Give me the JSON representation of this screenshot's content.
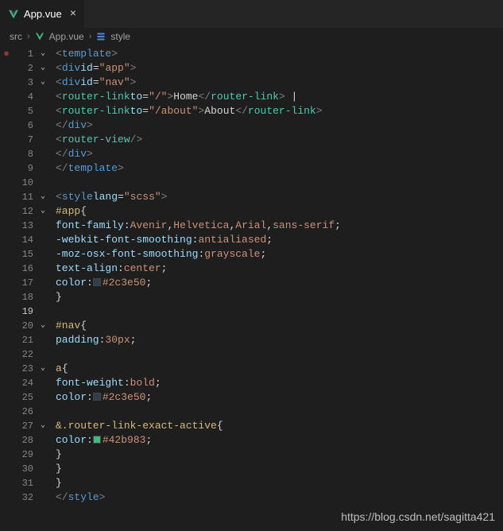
{
  "tab": {
    "filename": "App.vue",
    "close": "×"
  },
  "breadcrumb": {
    "item1": "src",
    "item2": "App.vue",
    "item3": "style",
    "chev": "›"
  },
  "lines": {
    "l1": {
      "n": "1",
      "html": "<span class='t-bracket'>&lt;</span><span class='t-tag'>template</span><span class='t-bracket'>&gt;</span>"
    },
    "l2": {
      "n": "2",
      "html": "  <span class='t-bracket'>&lt;</span><span class='t-tag'>div</span> <span class='t-attr'>id</span><span class='t-eq'>=</span><span class='t-str'>\"app\"</span><span class='t-bracket'>&gt;</span>"
    },
    "l3": {
      "n": "3",
      "html": "    <span class='t-bracket'>&lt;</span><span class='t-tag'>div</span> <span class='t-attr'>id</span><span class='t-eq'>=</span><span class='t-str'>\"nav\"</span><span class='t-bracket'>&gt;</span>"
    },
    "l4": {
      "n": "4",
      "html": "      <span class='t-bracket'>&lt;</span><span class='t-component'>router-link</span> <span class='t-attr'>to</span><span class='t-eq'>=</span><span class='t-str'>\"/\"</span><span class='t-bracket'>&gt;</span><span class='t-text'>Home</span><span class='t-bracket'>&lt;/</span><span class='t-component'>router-link</span><span class='t-bracket'>&gt;</span><span class='t-text'> |</span>"
    },
    "l5": {
      "n": "5",
      "html": "      <span class='t-bracket'>&lt;</span><span class='t-component'>router-link</span> <span class='t-attr'>to</span><span class='t-eq'>=</span><span class='t-str'>\"/about\"</span><span class='t-bracket'>&gt;</span><span class='t-text'>About</span><span class='t-bracket'>&lt;/</span><span class='t-component'>router-link</span><span class='t-bracket'>&gt;</span>"
    },
    "l6": {
      "n": "6",
      "html": "    <span class='t-bracket'>&lt;/</span><span class='t-tag'>div</span><span class='t-bracket'>&gt;</span>"
    },
    "l7": {
      "n": "7",
      "html": "    <span class='t-bracket'>&lt;</span><span class='t-component'>router-view</span><span class='t-bracket'>/&gt;</span>"
    },
    "l8": {
      "n": "8",
      "html": "  <span class='t-bracket'>&lt;/</span><span class='t-tag'>div</span><span class='t-bracket'>&gt;</span>"
    },
    "l9": {
      "n": "9",
      "html": "<span class='t-bracket'>&lt;/</span><span class='t-tag'>template</span><span class='t-bracket'>&gt;</span>"
    },
    "l10": {
      "n": "10",
      "html": ""
    },
    "l11": {
      "n": "11",
      "html": "<span class='t-bracket'>&lt;</span><span class='t-tag'>style</span> <span class='t-attr'>lang</span><span class='t-eq'>=</span><span class='t-str'>\"scss\"</span><span class='t-bracket'>&gt;</span>"
    },
    "l12": {
      "n": "12",
      "html": "<span class='t-sel'>#app</span> <span class='t-brace'>{</span>"
    },
    "l13": {
      "n": "13",
      "html": "  <span class='t-prop'>font-family</span><span class='t-colon'>:</span> <span class='t-val'>Avenir</span><span class='t-comma'>,</span> <span class='t-val'>Helvetica</span><span class='t-comma'>,</span> <span class='t-val'>Arial</span><span class='t-comma'>,</span> <span class='t-val'>sans-serif</span><span class='t-semi'>;</span>"
    },
    "l14": {
      "n": "14",
      "html": "  <span class='t-prop'>-webkit-font-smoothing</span><span class='t-colon'>:</span> <span class='t-val'>antialiased</span><span class='t-semi'>;</span>"
    },
    "l15": {
      "n": "15",
      "html": "  <span class='t-prop'>-moz-osx-font-smoothing</span><span class='t-colon'>:</span> <span class='t-val'>grayscale</span><span class='t-semi'>;</span>"
    },
    "l16": {
      "n": "16",
      "html": "  <span class='t-prop'>text-align</span><span class='t-colon'>:</span> <span class='t-val'>center</span><span class='t-semi'>;</span>"
    },
    "l17": {
      "n": "17",
      "html": "  <span class='t-prop'>color</span><span class='t-colon'>:</span> <span class='color-swatch' style='background:#2c3e50'></span><span class='t-val'>#2c3e50</span><span class='t-semi'>;</span>"
    },
    "l18": {
      "n": "18",
      "html": "<span class='t-brace'>}</span>"
    },
    "l19": {
      "n": "19",
      "html": ""
    },
    "l20": {
      "n": "20",
      "html": "<span class='t-sel'>#nav</span> <span class='t-brace'>{</span>"
    },
    "l21": {
      "n": "21",
      "html": "  <span class='t-prop'>padding</span><span class='t-colon'>:</span> <span class='t-val'>30px</span><span class='t-semi'>;</span>"
    },
    "l22": {
      "n": "22",
      "html": ""
    },
    "l23": {
      "n": "23",
      "html": "  <span class='t-sel'>a</span> <span class='t-brace'>{</span>"
    },
    "l24": {
      "n": "24",
      "html": "    <span class='t-prop'>font-weight</span><span class='t-colon'>:</span> <span class='t-val'>bold</span><span class='t-semi'>;</span>"
    },
    "l25": {
      "n": "25",
      "html": "    <span class='t-prop'>color</span><span class='t-colon'>:</span> <span class='color-swatch' style='background:#2c3e50'></span><span class='t-val'>#2c3e50</span><span class='t-semi'>;</span>"
    },
    "l26": {
      "n": "26",
      "html": ""
    },
    "l27": {
      "n": "27",
      "html": "    <span class='t-sel'>&amp;.router-link-exact-active</span> <span class='t-brace'>{</span>"
    },
    "l28": {
      "n": "28",
      "html": "      <span class='t-prop'>color</span><span class='t-colon'>:</span> <span class='color-swatch' style='background:#42b983'></span><span class='t-val'>#42b983</span><span class='t-semi'>;</span>"
    },
    "l29": {
      "n": "29",
      "html": "    <span class='t-brace'>}</span>"
    },
    "l30": {
      "n": "30",
      "html": "  <span class='t-brace'>}</span>"
    },
    "l31": {
      "n": "31",
      "html": "<span class='t-brace'>}</span>"
    },
    "l32": {
      "n": "32",
      "html": "<span class='t-bracket'>&lt;/</span><span class='t-tag'>style</span><span class='t-bracket'>&gt;</span>"
    }
  },
  "folds": [
    "1",
    "2",
    "3",
    "11",
    "12",
    "20",
    "23",
    "27"
  ],
  "marker_line": "1",
  "active_line": "19",
  "watermark": "https://blog.csdn.net/sagitta421"
}
